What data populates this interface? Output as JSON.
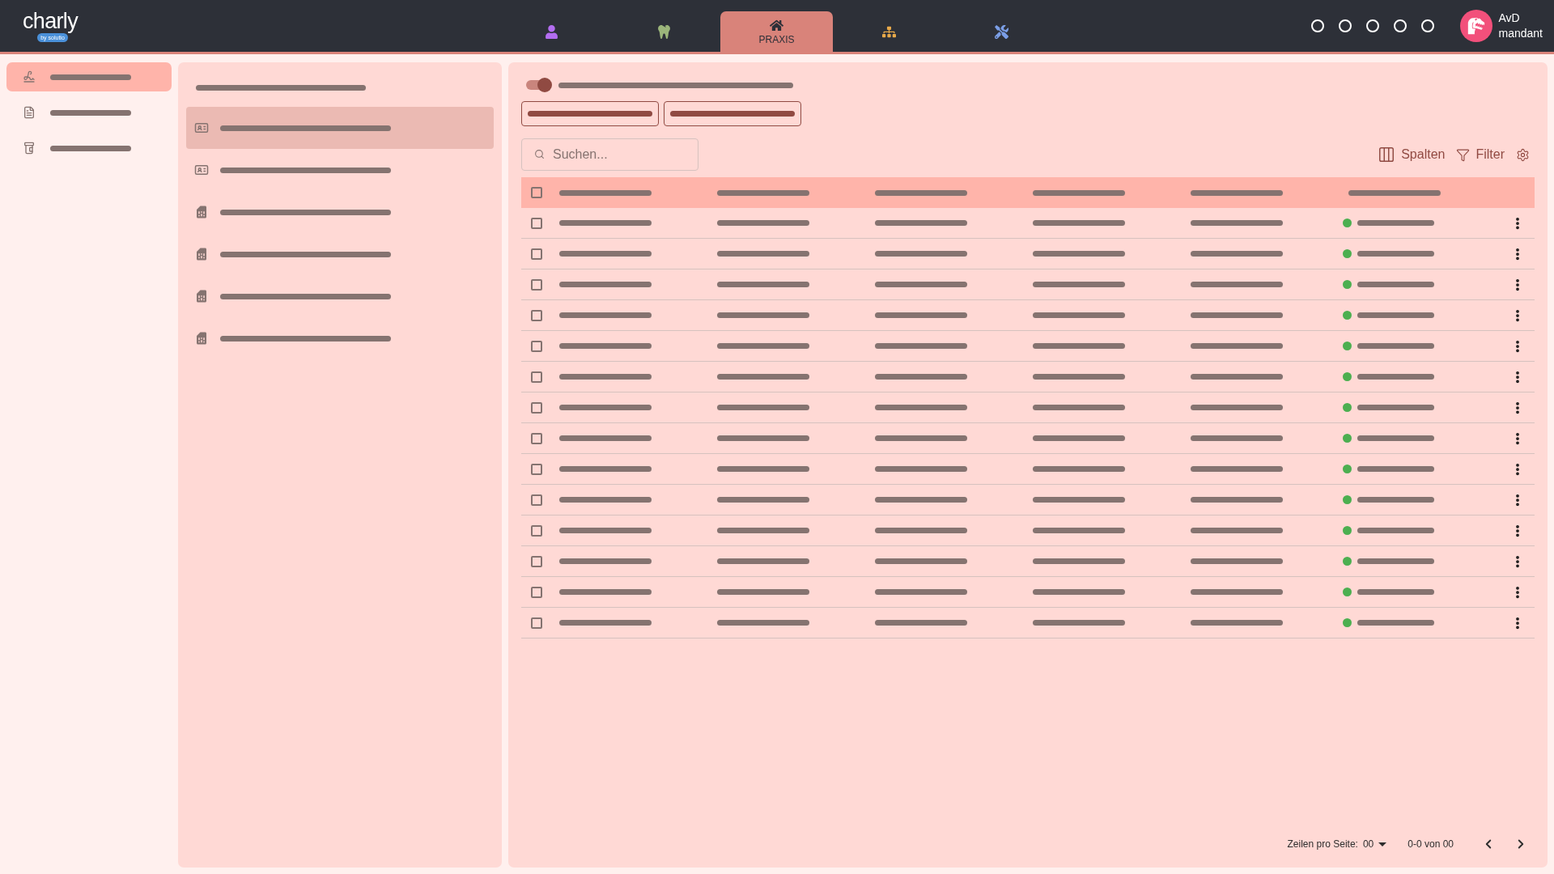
{
  "header": {
    "logo": {
      "name": "charly",
      "tagline": "by solutio"
    },
    "tabs": [
      {
        "kind": "person",
        "selected": false,
        "color": "#b36df0"
      },
      {
        "kind": "tooth",
        "selected": false,
        "color": "#9bb57a"
      },
      {
        "kind": "home",
        "selected": true,
        "label": "PRAXIS"
      },
      {
        "kind": "hierarchy",
        "selected": false,
        "color": "#e8a94a"
      },
      {
        "kind": "tools",
        "selected": false,
        "color": "#7b9ee6"
      }
    ],
    "indicators": [
      {
        "on": false
      },
      {
        "on": false
      },
      {
        "on": false
      },
      {
        "on": false
      },
      {
        "on": false
      }
    ],
    "user": {
      "line_1": "AvD",
      "line_2": "mandant"
    }
  },
  "sidebar": {
    "items": [
      {
        "kind": "signature",
        "selected": true
      },
      {
        "kind": "invoice",
        "selected": false
      },
      {
        "kind": "medicine",
        "selected": false
      }
    ]
  },
  "panel": {
    "items": [
      {
        "kind": "contact",
        "selected": true
      },
      {
        "kind": "contact",
        "selected": false
      },
      {
        "kind": "document",
        "selected": false
      },
      {
        "kind": "document",
        "selected": false
      },
      {
        "kind": "document",
        "selected": false
      },
      {
        "kind": "document",
        "selected": false
      }
    ]
  },
  "main": {
    "toggle": {
      "on": true
    },
    "buttons": [
      {
        "kind": "outlined"
      },
      {
        "kind": "outlined"
      }
    ],
    "search": {
      "placeholder": "Suchen..."
    },
    "tools": [
      {
        "kind": "columns",
        "label": "Spalten"
      },
      {
        "kind": "filter",
        "label": "Filter"
      },
      {
        "kind": "settings"
      }
    ],
    "table": {
      "header_checked": false,
      "columns": [
        {
          "kind": "text"
        },
        {
          "kind": "text"
        },
        {
          "kind": "text"
        },
        {
          "kind": "text"
        },
        {
          "kind": "text"
        },
        {
          "kind": "status"
        }
      ],
      "rows": [
        {
          "checked": false,
          "color": "#4caf50"
        },
        {
          "checked": false,
          "color": "#4caf50"
        },
        {
          "checked": false,
          "color": "#4caf50"
        },
        {
          "checked": false,
          "color": "#4caf50"
        },
        {
          "checked": false,
          "color": "#4caf50"
        },
        {
          "checked": false,
          "color": "#4caf50"
        },
        {
          "checked": false,
          "color": "#4caf50"
        },
        {
          "checked": false,
          "color": "#4caf50"
        },
        {
          "checked": false,
          "color": "#4caf50"
        },
        {
          "checked": false,
          "color": "#4caf50"
        },
        {
          "checked": false,
          "color": "#4caf50"
        },
        {
          "checked": false,
          "color": "#4caf50"
        },
        {
          "checked": false,
          "color": "#4caf50"
        },
        {
          "checked": false,
          "color": "#4caf50"
        }
      ]
    },
    "pagination": {
      "rows_label": "Zeilen pro Seite:",
      "rows_value": "00",
      "range": "0-0 von 00"
    }
  }
}
